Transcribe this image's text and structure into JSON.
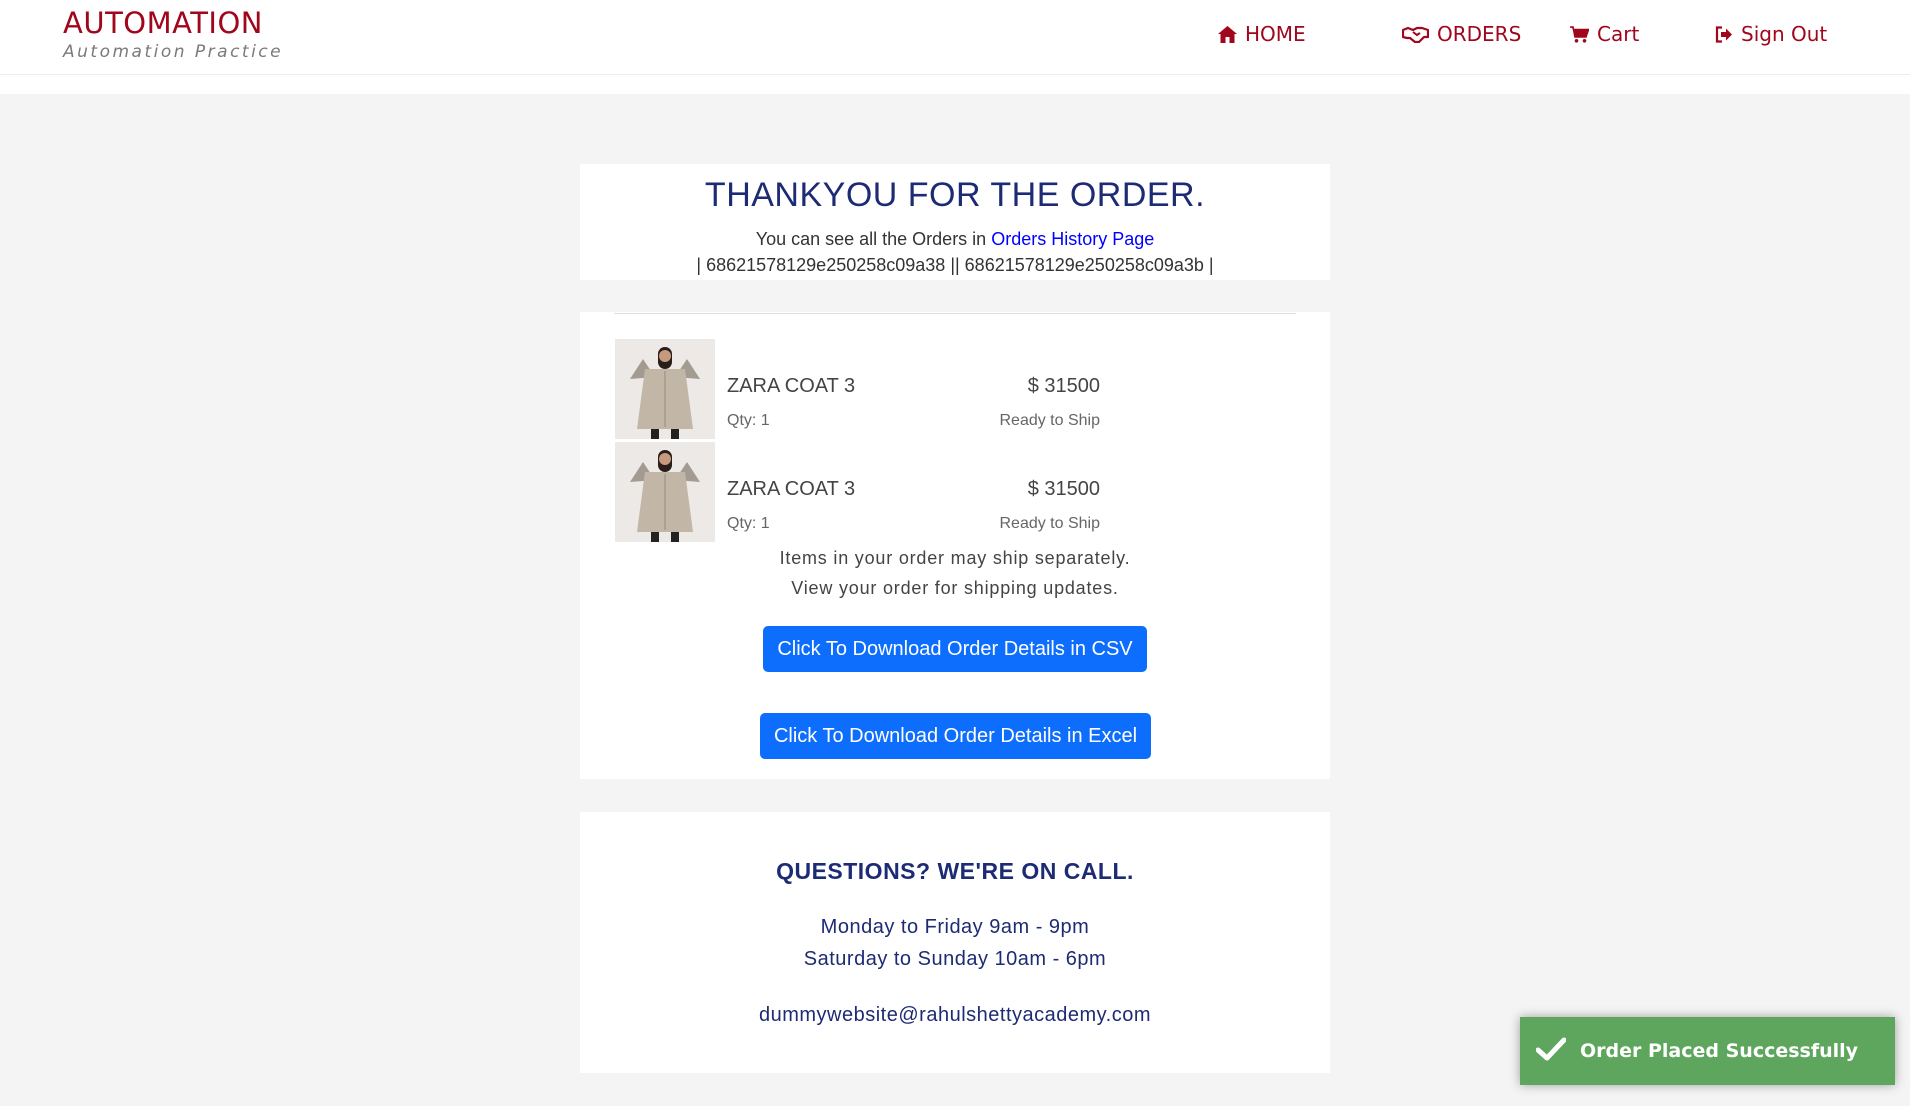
{
  "brand": {
    "title": "AUTOMATION",
    "subtitle": "Automation Practice"
  },
  "nav": {
    "home": "HOME",
    "orders": "ORDERS",
    "cart": "Cart",
    "sign_out": "Sign Out"
  },
  "confirmation": {
    "title": "THANKYOU FOR THE ORDER.",
    "history_prefix": "You can see all the Orders in",
    "history_link": "Orders History Page",
    "order_ids": "| 68621578129e250258c09a38 || 68621578129e250258c09a3b |"
  },
  "items": [
    {
      "name": "ZARA COAT 3",
      "price": "$ 31500",
      "qty": "Qty: 1",
      "status": "Ready to Ship"
    },
    {
      "name": "ZARA COAT 3",
      "price": "$ 31500",
      "qty": "Qty: 1",
      "status": "Ready to Ship"
    }
  ],
  "shipping_note": {
    "line1": "Items in your order may ship separately.",
    "line2": "View your order for shipping updates."
  },
  "buttons": {
    "csv": "Click To Download Order Details in CSV",
    "excel": "Click To Download Order Details in Excel"
  },
  "support": {
    "title": "QUESTIONS? WE'RE ON CALL.",
    "weekday_hours": "Monday to Friday 9am - 9pm",
    "weekend_hours": "Saturday to Sunday 10am - 6pm",
    "email": "dummywebsite@rahulshettyacademy.com"
  },
  "toast": {
    "message": "Order Placed Successfully"
  },
  "colors": {
    "brand_red": "#a0061c",
    "navy": "#1d2b74",
    "button_blue": "#0d6efd",
    "toast_green": "#5ea65e",
    "page_bg": "#f4f4f4"
  },
  "icons": {
    "home": "home-icon",
    "orders": "handshake-icon",
    "cart": "cart-icon",
    "sign_out": "sign-out-icon",
    "toast": "check-icon"
  }
}
